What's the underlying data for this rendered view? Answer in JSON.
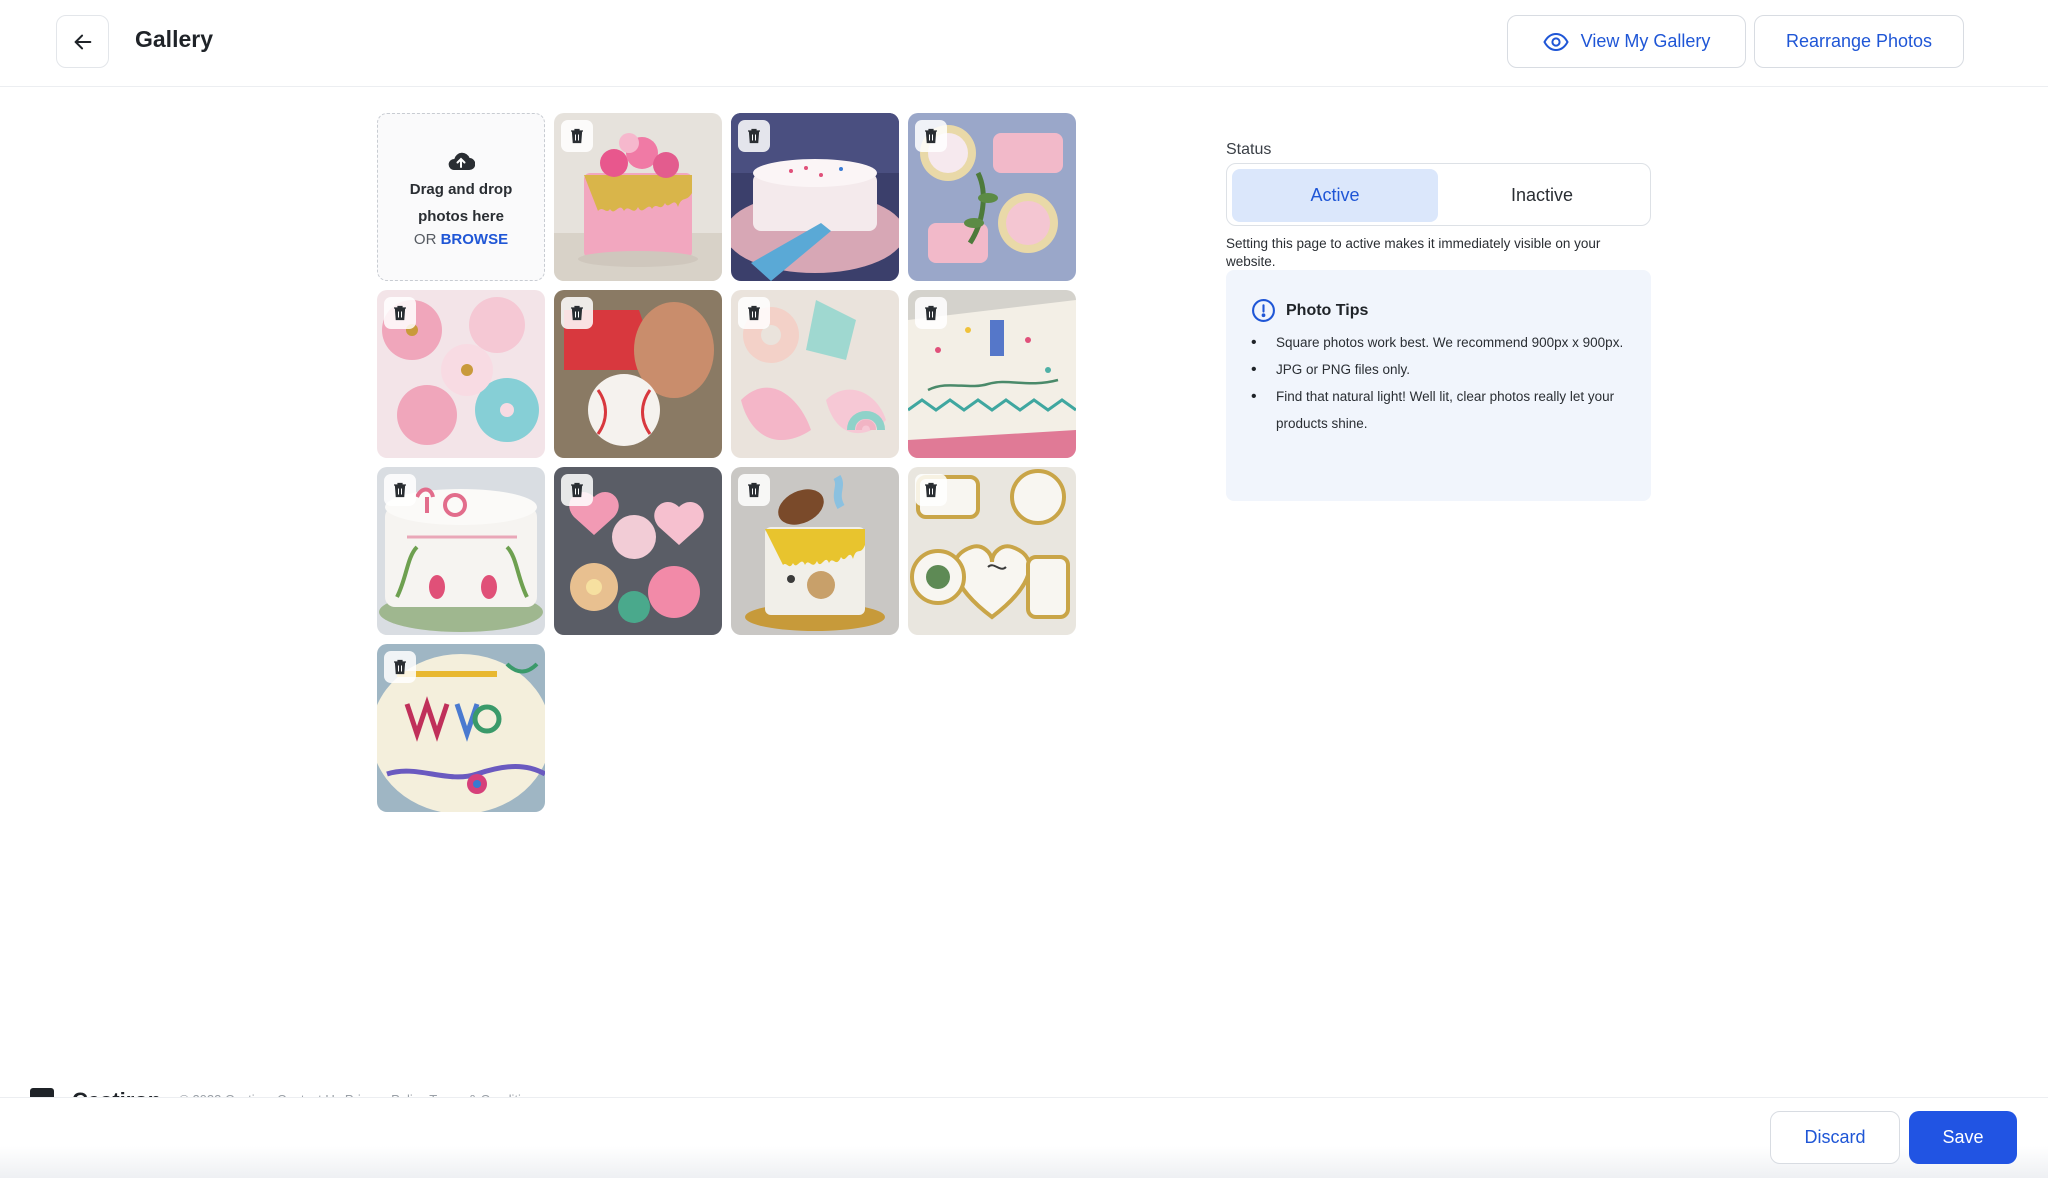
{
  "header": {
    "title": "Gallery",
    "view_gallery_label": "View My Gallery",
    "rearrange_label": "Rearrange Photos"
  },
  "upload": {
    "line1": "Drag and drop",
    "line2": "photos here",
    "or": "OR",
    "browse": "BROWSE"
  },
  "photos": [
    {
      "name": "pink-drip-cake"
    },
    {
      "name": "sprinkle-cake-slice"
    },
    {
      "name": "floral-sugar-cookies"
    },
    {
      "name": "pink-teacup-cookies"
    },
    {
      "name": "baseball-cookies"
    },
    {
      "name": "unicorn-cookies"
    },
    {
      "name": "birthday-sheet-cake"
    },
    {
      "name": "70-years-loved-cake"
    },
    {
      "name": "heart-flower-cookies"
    },
    {
      "name": "football-cake"
    },
    {
      "name": "she-said-yes-cookies"
    },
    {
      "name": "happy-birthday-maria-cake"
    }
  ],
  "status": {
    "label": "Status",
    "active_label": "Active",
    "inactive_label": "Inactive",
    "selected": "Active",
    "help": "Setting this page to active makes it immediately visible on your website."
  },
  "tips": {
    "title": "Photo Tips",
    "items": [
      "Square photos work best. We recommend 900px x 900px.",
      "JPG or PNG files only.",
      "Find that natural light! Well lit, clear photos really let your products shine."
    ]
  },
  "footer": {
    "brand": "Castiron",
    "copy": "© 2022 Castiron   Contact Us   Privacy Policy   Terms & Conditions"
  },
  "actions": {
    "discard_label": "Discard",
    "save_label": "Save"
  },
  "colors": {
    "accent": "#2154e3",
    "active_bg": "#dbe7fb",
    "tips_bg": "#f1f5fc"
  }
}
